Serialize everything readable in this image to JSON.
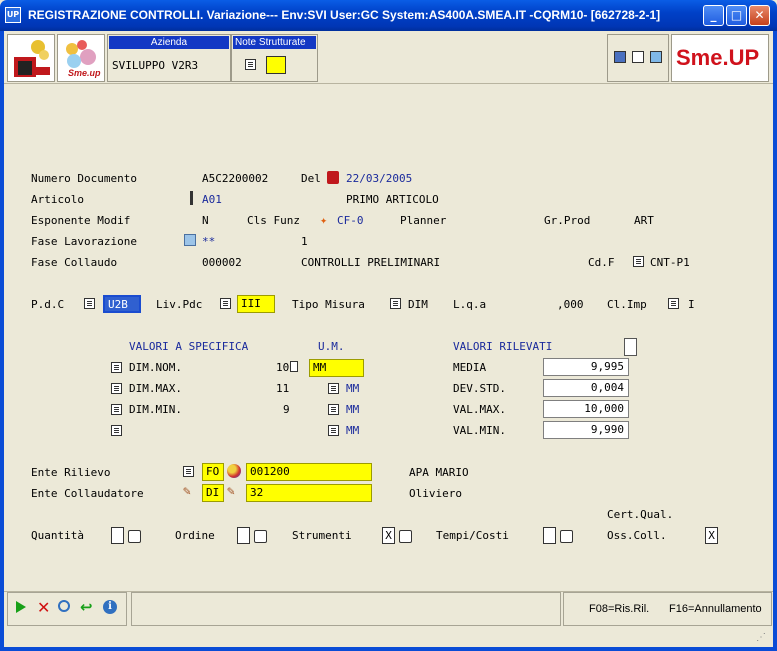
{
  "window": {
    "title": "REGISTRAZIONE CONTROLLI.  Variazione--- Env:SVI User:GC System:AS400A.SMEA.IT -CQRM10- [662728-2-1]",
    "app_icon": "UP"
  },
  "header": {
    "azienda_label": "Azienda",
    "azienda_value": "SVILUPPO V2R3",
    "note_label": "Note Strutturate",
    "logo_text": "Sme.UP",
    "logo_small_text": "Sme.up"
  },
  "form": {
    "numero_documento_label": "Numero Documento",
    "numero_documento_value": "A5C2200002",
    "del_label": "Del",
    "del_value": "22/03/2005",
    "articolo_label": "Articolo",
    "articolo_value": "A01",
    "articolo_desc": "PRIMO ARTICOLO",
    "esponente_label": "Esponente Modif",
    "esponente_value": "N",
    "cls_funz_label": "Cls Funz",
    "cls_funz_value": "CF-0",
    "planner_label": "Planner",
    "gr_prod_label": "Gr.Prod",
    "gr_prod_value": "ART",
    "fase_lav_label": "Fase Lavorazione",
    "fase_lav_value": "**",
    "fase_lav_num": "1",
    "fase_coll_label": "Fase Collaudo",
    "fase_coll_value": "000002",
    "fase_coll_desc": "CONTROLLI PRELIMINARI",
    "cdf_label": "Cd.F",
    "cdf_value": "CNT-P1",
    "pdc_label": "P.d.C",
    "pdc_value": "U2B",
    "liv_pdc_label": "Liv.Pdc",
    "liv_pdc_value": "III",
    "tipo_misura_label": "Tipo Misura",
    "tipo_misura_value": "DIM",
    "lqa_label": "L.q.a",
    "lqa_value": ",000",
    "cl_imp_label": "Cl.Imp",
    "cl_imp_value": "I"
  },
  "specifica": {
    "header": "VALORI A SPECIFICA",
    "um_header": "U.M.",
    "rows": [
      {
        "label": "DIM.NOM.",
        "value": "10",
        "um": "MM"
      },
      {
        "label": "DIM.MAX.",
        "value": "11",
        "um": "MM"
      },
      {
        "label": "DIM.MIN.",
        "value": "9",
        "um": "MM"
      },
      {
        "label": "",
        "value": "",
        "um": "MM"
      }
    ]
  },
  "rilevati": {
    "header": "VALORI RILEVATI",
    "rows": [
      {
        "label": "MEDIA",
        "value": "9,995"
      },
      {
        "label": "DEV.STD.",
        "value": "0,004"
      },
      {
        "label": "VAL.MAX.",
        "value": "10,000"
      },
      {
        "label": "VAL.MIN.",
        "value": "9,990"
      }
    ]
  },
  "ente": {
    "rilievo_label": "Ente Rilievo",
    "rilievo_code": "FO",
    "rilievo_value": "001200",
    "rilievo_name": "APA MARIO",
    "collaudatore_label": "Ente Collaudatore",
    "collaudatore_code": "DI",
    "collaudatore_value": "32",
    "collaudatore_name": "Oliviero"
  },
  "checks": {
    "quantita_label": "Quantità",
    "ordine_label": "Ordine",
    "strumenti_label": "Strumenti",
    "strumenti_value": "X",
    "tempi_label": "Tempi/Costi",
    "cert_label": "Cert.Qual.",
    "oss_label": "Oss.Coll.",
    "oss_value": "X"
  },
  "status": {
    "f08": "F08=Ris.Ril.",
    "f16": "F16=Annullamento"
  },
  "colors": {
    "title_blue": "#0041c8",
    "highlight_yellow": "#ffff00",
    "field_blue": "#1a2a9c",
    "logo_red": "#d0121c"
  }
}
